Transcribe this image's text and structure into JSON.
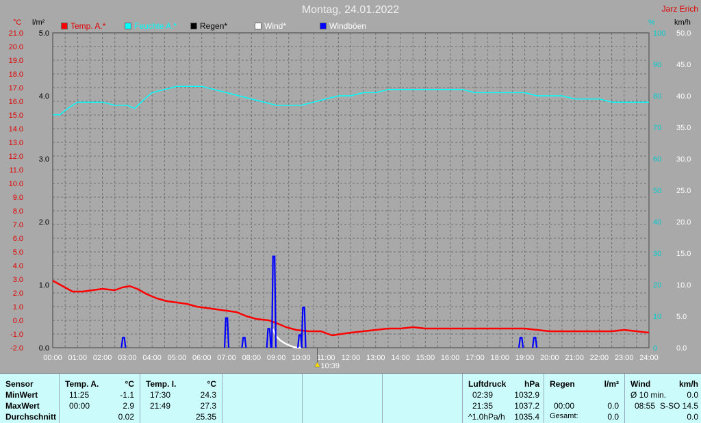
{
  "title": "Montag, 24.01.2022",
  "author": "Jarz Erich",
  "legend": [
    {
      "label": "Temp. A.*",
      "color": "#ff0000"
    },
    {
      "label": "Feuchte A.*",
      "color": "#00ffff"
    },
    {
      "label": "Regen*",
      "color": "#000000"
    },
    {
      "label": "Wind*",
      "color": "#ffffff"
    },
    {
      "label": "Windböen",
      "color": "#0000ff"
    }
  ],
  "units": {
    "temp": "°C",
    "rain": "l/m²",
    "humidity": "%",
    "wind": "km/h"
  },
  "time_marker": "10:39",
  "chart_data": {
    "type": "line",
    "title": "Montag, 24.01.2022",
    "x_range": [
      0,
      24
    ],
    "x_ticks": [
      "00:00",
      "01:00",
      "02:00",
      "03:00",
      "04:00",
      "05:00",
      "06:00",
      "07:00",
      "08:00",
      "09:00",
      "10:00",
      "11:00",
      "12:00",
      "13:00",
      "14:00",
      "15:00",
      "16:00",
      "17:00",
      "18:00",
      "19:00",
      "20:00",
      "21:00",
      "22:00",
      "23:00",
      "24:00"
    ],
    "axes": {
      "temp": {
        "range": [
          -2.0,
          21.0
        ],
        "ticks": [
          "21.0",
          "20.0",
          "19.0",
          "18.0",
          "17.0",
          "16.0",
          "15.0",
          "14.0",
          "13.0",
          "12.0",
          "11.0",
          "10.0",
          "9.0",
          "8.0",
          "7.0",
          "6.0",
          "5.0",
          "4.0",
          "3.0",
          "2.0",
          "1.0",
          "0.0",
          "-1.0",
          "-2.0"
        ]
      },
      "rain": {
        "range": [
          0.0,
          5.0
        ],
        "ticks": [
          "5.0",
          "4.0",
          "3.0",
          "2.0",
          "1.0",
          "0.0"
        ]
      },
      "humidity": {
        "range": [
          0,
          100
        ],
        "ticks": [
          "100",
          "90",
          "80",
          "70",
          "60",
          "50",
          "40",
          "30",
          "20",
          "10",
          "0"
        ]
      },
      "wind": {
        "range": [
          0.0,
          50.0
        ],
        "ticks": [
          "50.0",
          "45.0",
          "40.0",
          "35.0",
          "30.0",
          "25.0",
          "20.0",
          "15.0",
          "10.0",
          "5.0",
          "0.0"
        ]
      }
    },
    "grid": true,
    "series": [
      {
        "name": "Temp. A.*",
        "axis": "temp",
        "color": "#ff0000",
        "points": [
          [
            0,
            2.9
          ],
          [
            0.5,
            2.4
          ],
          [
            0.8,
            2.1
          ],
          [
            1.2,
            2.1
          ],
          [
            1.6,
            2.2
          ],
          [
            2.0,
            2.3
          ],
          [
            2.5,
            2.2
          ],
          [
            2.8,
            2.4
          ],
          [
            3.1,
            2.5
          ],
          [
            3.4,
            2.3
          ],
          [
            3.8,
            1.9
          ],
          [
            4.2,
            1.6
          ],
          [
            4.6,
            1.4
          ],
          [
            5.0,
            1.3
          ],
          [
            5.4,
            1.2
          ],
          [
            5.8,
            1.0
          ],
          [
            6.2,
            0.9
          ],
          [
            6.6,
            0.8
          ],
          [
            7.0,
            0.7
          ],
          [
            7.4,
            0.6
          ],
          [
            7.8,
            0.3
          ],
          [
            8.2,
            0.1
          ],
          [
            8.7,
            0.0
          ],
          [
            9.0,
            -0.2
          ],
          [
            9.4,
            -0.5
          ],
          [
            9.8,
            -0.7
          ],
          [
            10.3,
            -0.8
          ],
          [
            10.8,
            -0.8
          ],
          [
            11.25,
            -1.1
          ],
          [
            11.6,
            -1.0
          ],
          [
            12.0,
            -0.9
          ],
          [
            12.5,
            -0.8
          ],
          [
            13.0,
            -0.7
          ],
          [
            13.5,
            -0.6
          ],
          [
            14.0,
            -0.6
          ],
          [
            14.5,
            -0.5
          ],
          [
            15.0,
            -0.6
          ],
          [
            15.5,
            -0.6
          ],
          [
            16.0,
            -0.6
          ],
          [
            16.5,
            -0.6
          ],
          [
            17.0,
            -0.6
          ],
          [
            17.5,
            -0.6
          ],
          [
            18.0,
            -0.6
          ],
          [
            18.5,
            -0.6
          ],
          [
            19.0,
            -0.6
          ],
          [
            19.5,
            -0.7
          ],
          [
            20.0,
            -0.8
          ],
          [
            20.5,
            -0.8
          ],
          [
            21.0,
            -0.8
          ],
          [
            21.5,
            -0.8
          ],
          [
            22.0,
            -0.8
          ],
          [
            22.5,
            -0.8
          ],
          [
            23.0,
            -0.7
          ],
          [
            23.5,
            -0.8
          ],
          [
            24.0,
            -0.9
          ]
        ]
      },
      {
        "name": "Feuchte A.*",
        "axis": "humidity",
        "color": "#00ffff",
        "points": [
          [
            0,
            74
          ],
          [
            0.3,
            74
          ],
          [
            0.6,
            76
          ],
          [
            1.0,
            78
          ],
          [
            1.5,
            78
          ],
          [
            2.0,
            78
          ],
          [
            2.5,
            77
          ],
          [
            3.0,
            77
          ],
          [
            3.3,
            76
          ],
          [
            3.7,
            79
          ],
          [
            4.0,
            81
          ],
          [
            4.5,
            82
          ],
          [
            5.0,
            83
          ],
          [
            5.5,
            83
          ],
          [
            6.0,
            83
          ],
          [
            6.5,
            82
          ],
          [
            7.0,
            81
          ],
          [
            7.5,
            80
          ],
          [
            8.0,
            79
          ],
          [
            8.5,
            78
          ],
          [
            9.0,
            77
          ],
          [
            9.5,
            77
          ],
          [
            10.0,
            77
          ],
          [
            10.5,
            78
          ],
          [
            11.0,
            79
          ],
          [
            11.5,
            80
          ],
          [
            12.0,
            80
          ],
          [
            12.5,
            81
          ],
          [
            13.0,
            81
          ],
          [
            13.5,
            82
          ],
          [
            14.0,
            82
          ],
          [
            14.5,
            82
          ],
          [
            15.0,
            82
          ],
          [
            15.5,
            82
          ],
          [
            16.0,
            82
          ],
          [
            16.5,
            82
          ],
          [
            17.0,
            81
          ],
          [
            17.5,
            81
          ],
          [
            18.0,
            81
          ],
          [
            18.5,
            81
          ],
          [
            19.0,
            81
          ],
          [
            19.5,
            80
          ],
          [
            20.0,
            80
          ],
          [
            20.5,
            80
          ],
          [
            21.0,
            79
          ],
          [
            21.5,
            79
          ],
          [
            22.0,
            79
          ],
          [
            22.5,
            78
          ],
          [
            23.0,
            78
          ],
          [
            23.5,
            78
          ],
          [
            24.0,
            78
          ]
        ]
      },
      {
        "name": "Wind*",
        "axis": "wind",
        "color": "#ffffff",
        "points": [
          [
            8.85,
            3.0
          ],
          [
            9.0,
            1.8
          ],
          [
            9.15,
            1.2
          ],
          [
            9.3,
            0.8
          ],
          [
            9.5,
            0.4
          ],
          [
            9.7,
            0.1
          ],
          [
            9.9,
            0.0
          ],
          [
            10.0,
            0.0
          ]
        ]
      },
      {
        "name": "Windböen",
        "axis": "wind",
        "color": "#0000ff",
        "spikes": [
          [
            2.85,
            1.6
          ],
          [
            7.0,
            4.7
          ],
          [
            7.7,
            1.6
          ],
          [
            8.7,
            3.0
          ],
          [
            8.9,
            14.5
          ],
          [
            9.95,
            2.0
          ],
          [
            10.1,
            6.4
          ],
          [
            18.85,
            1.6
          ],
          [
            19.4,
            1.6
          ]
        ]
      }
    ]
  },
  "table": {
    "sensor": {
      "header": "Sensor",
      "rows": [
        "MinWert",
        "MaxWert",
        "Durchschnitt"
      ]
    },
    "temp_a": {
      "header": "Temp. A.",
      "unit": "°C",
      "rows": [
        [
          "11:25",
          "-1.1"
        ],
        [
          "00:00",
          "2.9"
        ],
        [
          "",
          "0.02"
        ]
      ]
    },
    "temp_i": {
      "header": "Temp. I.",
      "unit": "°C",
      "rows": [
        [
          "17:30",
          "24.3"
        ],
        [
          "21:49",
          "27.3"
        ],
        [
          "",
          "25.35"
        ]
      ]
    },
    "pressure": {
      "header": "Luftdruck",
      "unit": "hPa",
      "rows": [
        [
          "02:39",
          "1032.9"
        ],
        [
          "21:35",
          "1037.2"
        ],
        [
          "^1.0hPa/h",
          "1035.4"
        ]
      ]
    },
    "rain": {
      "header": "Regen",
      "unit": "l/m²",
      "rows": [
        [
          "",
          ""
        ],
        [
          "00:00",
          "0.0"
        ],
        [
          "Gesamt:",
          "0.0"
        ]
      ],
      "first_value": "0.0"
    },
    "wind": {
      "header": "Wind",
      "unit": "km/h",
      "rows": [
        [
          "Ø 10 min.",
          "0.0"
        ],
        [
          "08:55",
          "S-SO 14.5"
        ],
        [
          "",
          "0.0"
        ]
      ]
    }
  }
}
